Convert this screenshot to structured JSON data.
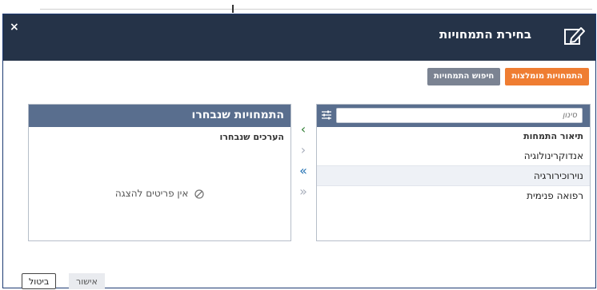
{
  "dialog": {
    "title": "בחירת התמחויות",
    "close_label": "×"
  },
  "tabs": {
    "recommended": "התמחויות מומלצות",
    "search": "חיפוש התמחויות"
  },
  "left_panel": {
    "title": "התמחויות שנבחרו",
    "subtitle": "הערכים שנבחרו",
    "empty_text": "אין פריטים להצגה"
  },
  "right_panel": {
    "search_placeholder": "סינון",
    "column_header": "תיאור התמחות",
    "items": [
      "אנדוקרינולוגיה",
      "נוירוכירורגיה",
      "רפואה פנימית"
    ]
  },
  "arrows": {
    "move_left": "‹",
    "move_right": "›",
    "move_all_left": "«",
    "move_all_right": "»"
  },
  "buttons": {
    "ok": "אישור",
    "cancel": "ביטול"
  },
  "colors": {
    "header_bg": "#253348",
    "accent_orange": "#ef7d32",
    "panel_header": "#596e8e"
  }
}
